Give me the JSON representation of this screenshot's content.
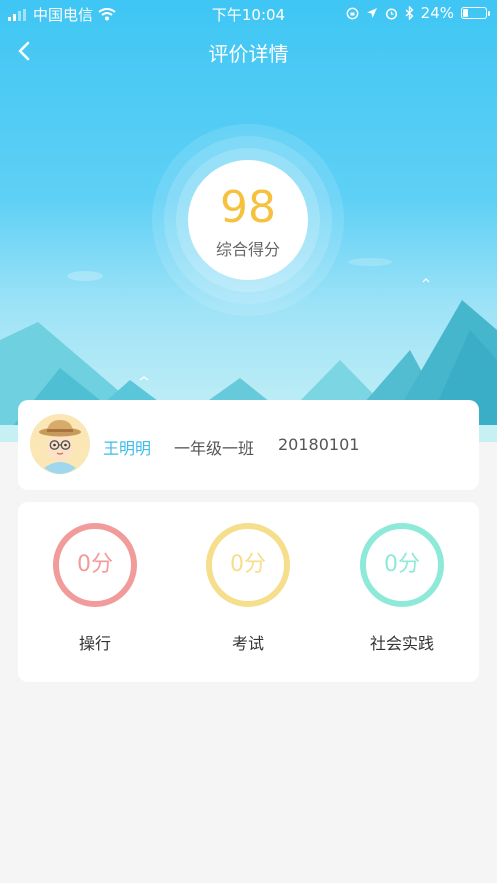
{
  "status_bar": {
    "carrier": "中国电信",
    "time": "下午10:04",
    "battery": "24%",
    "battery_level": 0.24
  },
  "nav": {
    "title": "评价详情",
    "back_icon": "chevron-left-icon"
  },
  "score": {
    "value": "98",
    "label": "综合得分"
  },
  "student": {
    "name": "王明明",
    "class": "一年级一班",
    "id": "20180101"
  },
  "categories": [
    {
      "score": "0分",
      "label": "操行",
      "color": "#f29b9b"
    },
    {
      "score": "0分",
      "label": "考试",
      "color": "#f5de8c"
    },
    {
      "score": "0分",
      "label": "社会实践",
      "color": "#8fe9d9"
    }
  ],
  "colors": {
    "accent": "#3ebcea",
    "score": "#f6c23e"
  }
}
